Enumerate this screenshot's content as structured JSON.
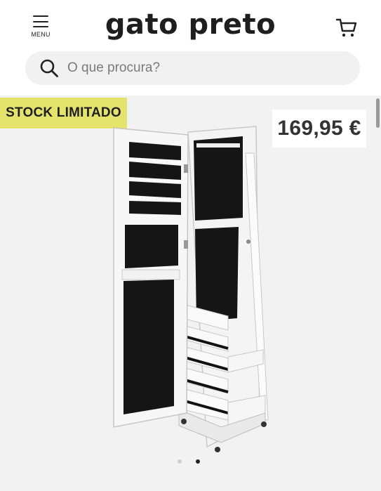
{
  "header": {
    "menu_label": "MENU",
    "logo": "gato preto",
    "icons": {
      "menu": "hamburger-icon",
      "cart": "cart-icon",
      "search": "search-icon"
    }
  },
  "search": {
    "placeholder": "O que procura?",
    "value": ""
  },
  "product": {
    "badge": "STOCK LIMITADO",
    "price": "169,95 €",
    "image": "jewelry-mirror-cabinet-image",
    "carousel": {
      "total": 2,
      "active": 2
    }
  },
  "colors": {
    "badge_bg": "#e4e36c",
    "text": "#222222",
    "page_bg": "#f2f2f2"
  }
}
